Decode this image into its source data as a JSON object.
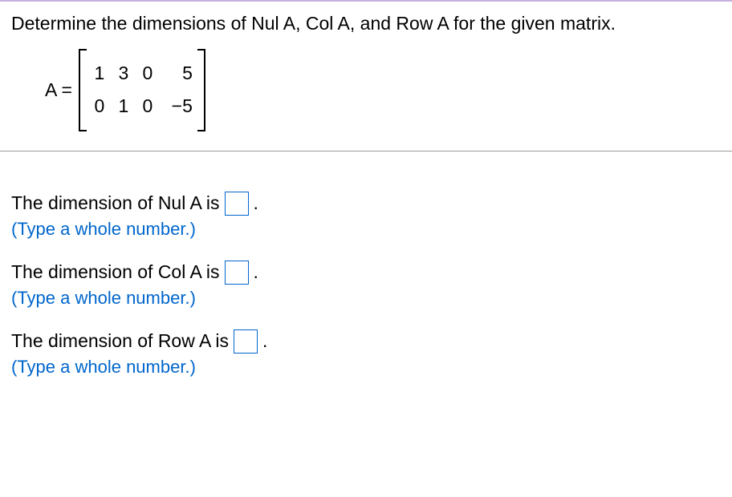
{
  "question": {
    "prompt": "Determine the dimensions of Nul A, Col A, and Row A for the given matrix.",
    "matrix_label": "A =",
    "matrix": {
      "rows": [
        [
          "1",
          "3",
          "0",
          "5"
        ],
        [
          "0",
          "1",
          "0",
          "−5"
        ]
      ]
    }
  },
  "answers": {
    "nul": {
      "prefix": "The dimension of Nul A is",
      "suffix": ".",
      "hint": "(Type a whole number.)",
      "value": ""
    },
    "col": {
      "prefix": "The dimension of Col A is",
      "suffix": ".",
      "hint": "(Type a whole number.)",
      "value": ""
    },
    "row": {
      "prefix": "The dimension of Row A is",
      "suffix": ".",
      "hint": "(Type a whole number.)",
      "value": ""
    }
  }
}
